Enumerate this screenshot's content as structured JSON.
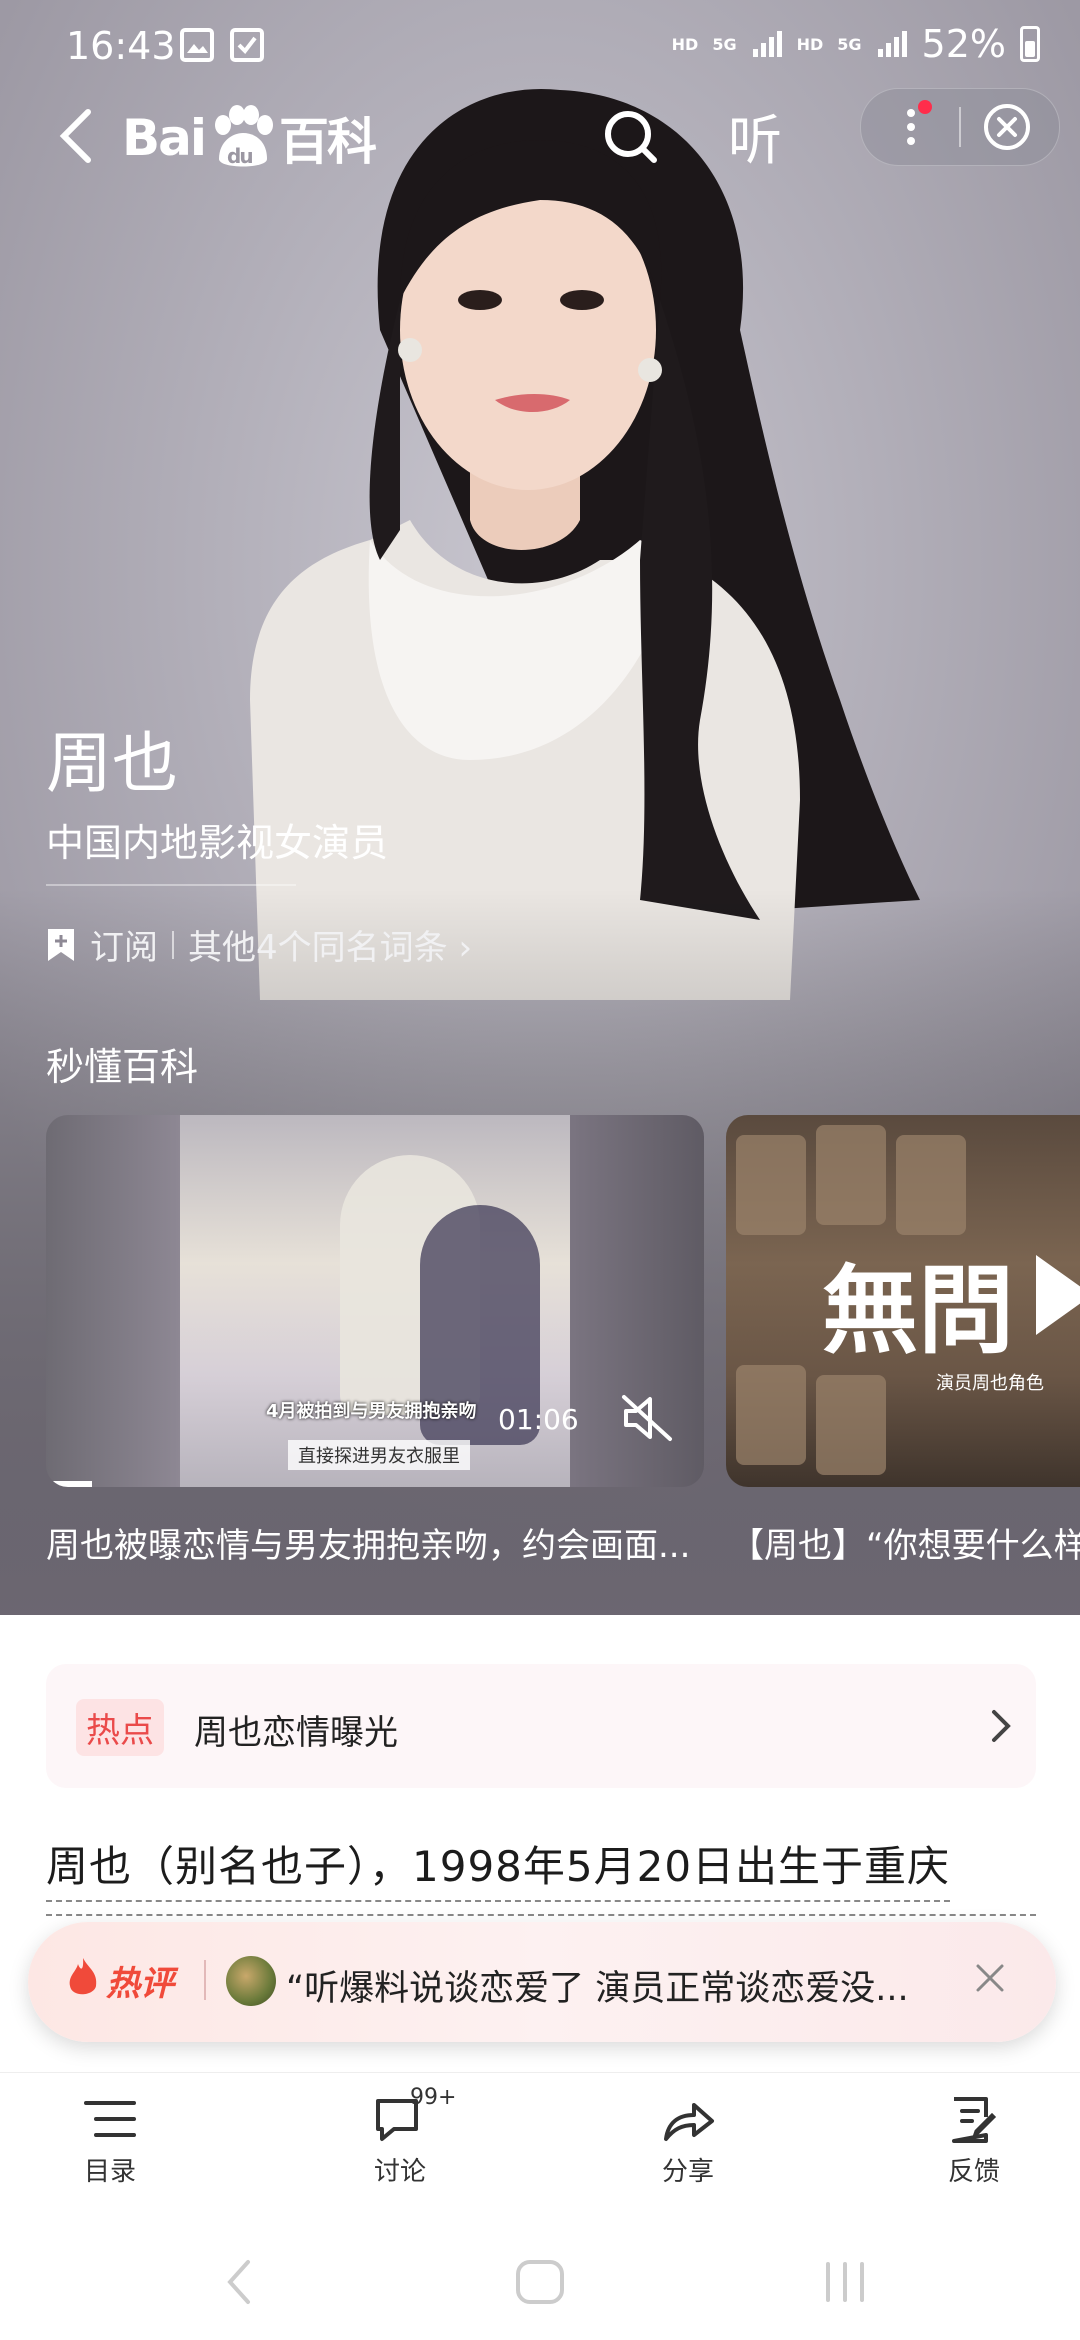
{
  "status_bar": {
    "time": "16:43",
    "hd1": "HD",
    "net1": "5G",
    "hd2": "HD",
    "net2": "5G",
    "battery": "52%"
  },
  "nav": {
    "logo_text_a": "Bai",
    "logo_text_b": "du",
    "logo_text_c": "百科",
    "listen": "听"
  },
  "hero": {
    "name": "周也",
    "description": "中国内地影视女演员",
    "subscribe": "订阅",
    "same_name": "其他4个同名词条 ›",
    "section_title": "秒懂百科"
  },
  "videos": [
    {
      "caption_top": "4月被拍到与男友拥抱亲吻",
      "caption_bottom": "直接探进男友衣服里",
      "duration": "01:06",
      "progress_fraction": 0.07,
      "title": "周也被曝恋情与男友拥抱亲吻，约会画面..."
    },
    {
      "overlay_big": "無問",
      "overlay_small": "演员周也角色",
      "title": "【周也】“你想要什么样"
    }
  ],
  "hot_topic": {
    "tag": "热点",
    "text": "周也恋情曝光"
  },
  "intro_text": "周也（别名也子），1998年5月20日出生于重庆",
  "hot_comment": {
    "label": "热评",
    "text": "“听爆料说谈恋爱了 演员正常谈恋爱没..."
  },
  "bottom_bar": {
    "toc": "目录",
    "discuss": "讨论",
    "discuss_badge": "99+",
    "share": "分享",
    "feedback": "反馈"
  },
  "icons": [
    "back-icon",
    "search-icon",
    "more-icon",
    "close-circle-icon",
    "bookmark-icon",
    "mute-icon",
    "flame-icon",
    "list-icon",
    "comment-icon",
    "share-icon",
    "feedback-icon"
  ],
  "colors": {
    "hot_red": "#ea4a4a",
    "hot_bg": "#fde3e4",
    "notify_dot": "#ff2d4b"
  }
}
